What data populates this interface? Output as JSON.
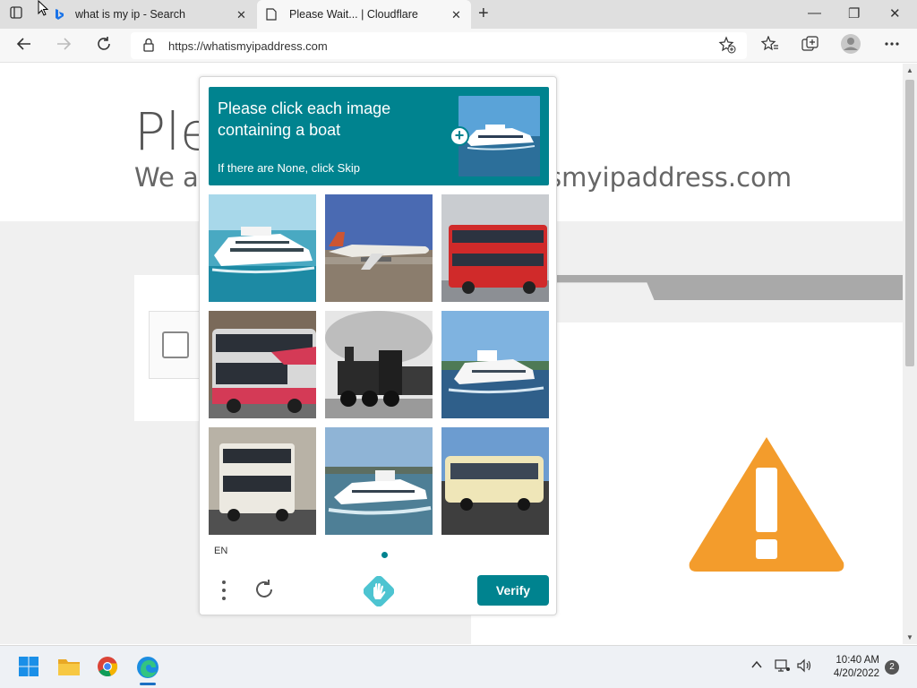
{
  "browser": {
    "tabs": [
      {
        "label": "what is my ip - Search",
        "close": "✕"
      },
      {
        "label": "Please Wait... | Cloudflare",
        "close": "✕"
      }
    ],
    "new_tab": "+",
    "window": {
      "minimize": "—",
      "maximize": "❐",
      "close": "✕"
    },
    "address": {
      "url": "https://whatismyipaddress.com"
    }
  },
  "page": {
    "heading": "Ple",
    "subheading_left": "We ar",
    "subheading_right": "smyipaddress.com",
    "warning_color": "#f39c2c"
  },
  "captcha": {
    "prompt_line": "Please click each image containing a boat",
    "skip_hint": "If there are None, click Skip",
    "grid": [
      {
        "subject": "boat"
      },
      {
        "subject": "airplane"
      },
      {
        "subject": "bus"
      },
      {
        "subject": "bus"
      },
      {
        "subject": "train"
      },
      {
        "subject": "boat"
      },
      {
        "subject": "bus"
      },
      {
        "subject": "boat"
      },
      {
        "subject": "bus"
      }
    ],
    "language": "EN",
    "verify_label": "Verify",
    "accent": "#00838f"
  },
  "taskbar": {
    "time": "10:40 AM",
    "date": "4/20/2022",
    "notifications": "2"
  }
}
